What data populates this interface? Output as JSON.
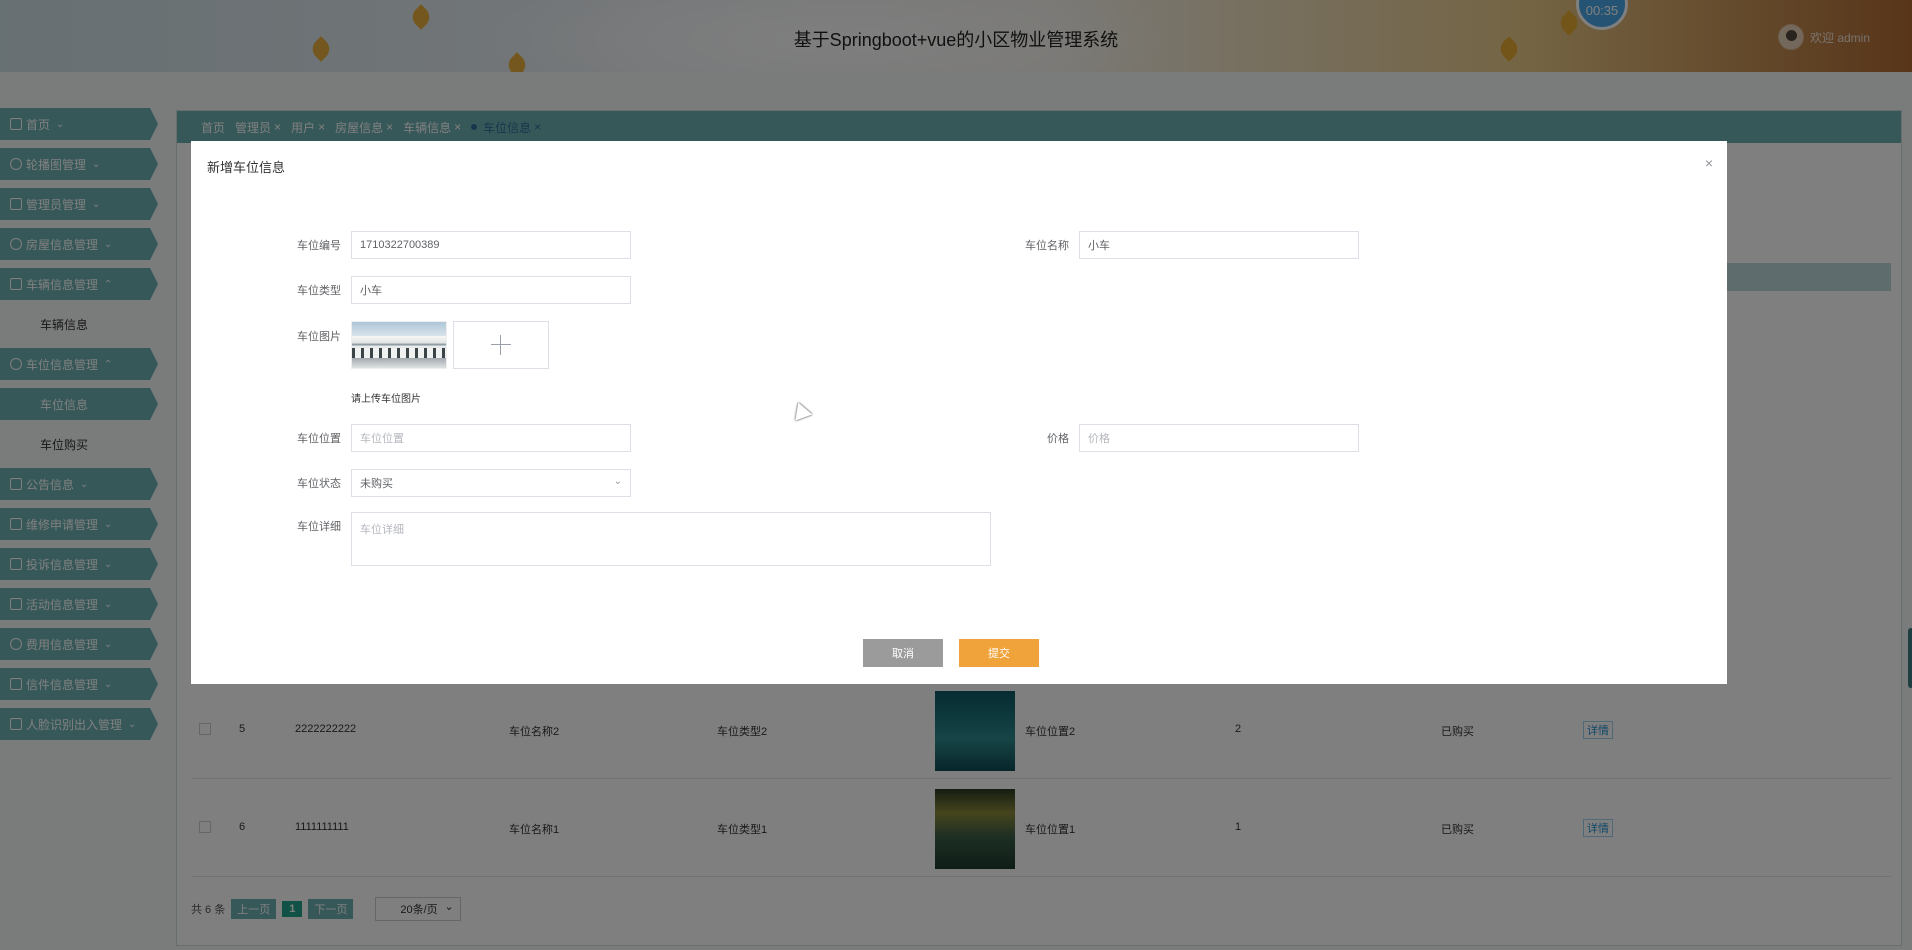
{
  "header": {
    "title": "基于Springboot+vue的小区物业管理系统",
    "timer": "00:35",
    "greeting": "欢迎 admin"
  },
  "sidebar": {
    "items": [
      {
        "label": "首页",
        "icon": "home-icon"
      },
      {
        "label": "轮播图管理",
        "icon": "image-icon"
      },
      {
        "label": "管理员管理",
        "icon": "user-icon"
      },
      {
        "label": "房屋信息管理",
        "icon": "building-icon"
      },
      {
        "label": "车辆信息管理",
        "icon": "car-icon"
      },
      {
        "label": "车辆信息",
        "sub": true
      },
      {
        "label": "车位信息管理",
        "icon": "parking-icon"
      },
      {
        "label": "车位信息",
        "sub": true,
        "active": true
      },
      {
        "label": "车位购买",
        "sub": true
      },
      {
        "label": "公告信息",
        "icon": "notice-icon"
      },
      {
        "label": "维修申请管理",
        "icon": "repair-icon"
      },
      {
        "label": "投诉信息管理",
        "icon": "complaint-icon"
      },
      {
        "label": "活动信息管理",
        "icon": "activity-icon"
      },
      {
        "label": "费用信息管理",
        "icon": "fee-icon"
      },
      {
        "label": "信件信息管理",
        "icon": "mail-icon"
      },
      {
        "label": "人脸识别出入管理",
        "icon": "face-icon"
      }
    ]
  },
  "tabs": [
    {
      "label": "首页",
      "closable": false
    },
    {
      "label": "管理员",
      "closable": true
    },
    {
      "label": "用户",
      "closable": true
    },
    {
      "label": "房屋信息",
      "closable": true
    },
    {
      "label": "车辆信息",
      "closable": true
    },
    {
      "label": "车位信息",
      "closable": true,
      "active": true
    }
  ],
  "table": {
    "rows": [
      {
        "id": "5",
        "code": "2222222222",
        "name": "车位名称2",
        "type": "车位类型2",
        "location": "车位位置2",
        "price": "2",
        "status": "已购买",
        "action": "详情"
      },
      {
        "id": "6",
        "code": "1111111111",
        "name": "车位名称1",
        "type": "车位类型1",
        "location": "车位位置1",
        "price": "1",
        "status": "已购买",
        "action": "详情"
      }
    ]
  },
  "pager": {
    "total": "共 6 条",
    "prev": "上一页",
    "page": "1",
    "next": "下一页",
    "size": "20条/页"
  },
  "dialog": {
    "title": "新增车位信息",
    "close": "×",
    "fields": {
      "code_label": "车位编号",
      "code_value": "1710322700389",
      "name_label": "车位名称",
      "name_value": "小车",
      "type_label": "车位类型",
      "type_value": "小车",
      "image_label": "车位图片",
      "image_hint": "请上传车位图片",
      "location_label": "车位位置",
      "location_placeholder": "车位位置",
      "price_label": "价格",
      "price_placeholder": "价格",
      "status_label": "车位状态",
      "status_value": "未购买",
      "detail_label": "车位详细",
      "detail_placeholder": "车位详细"
    },
    "buttons": {
      "cancel": "取消",
      "submit": "提交"
    }
  }
}
